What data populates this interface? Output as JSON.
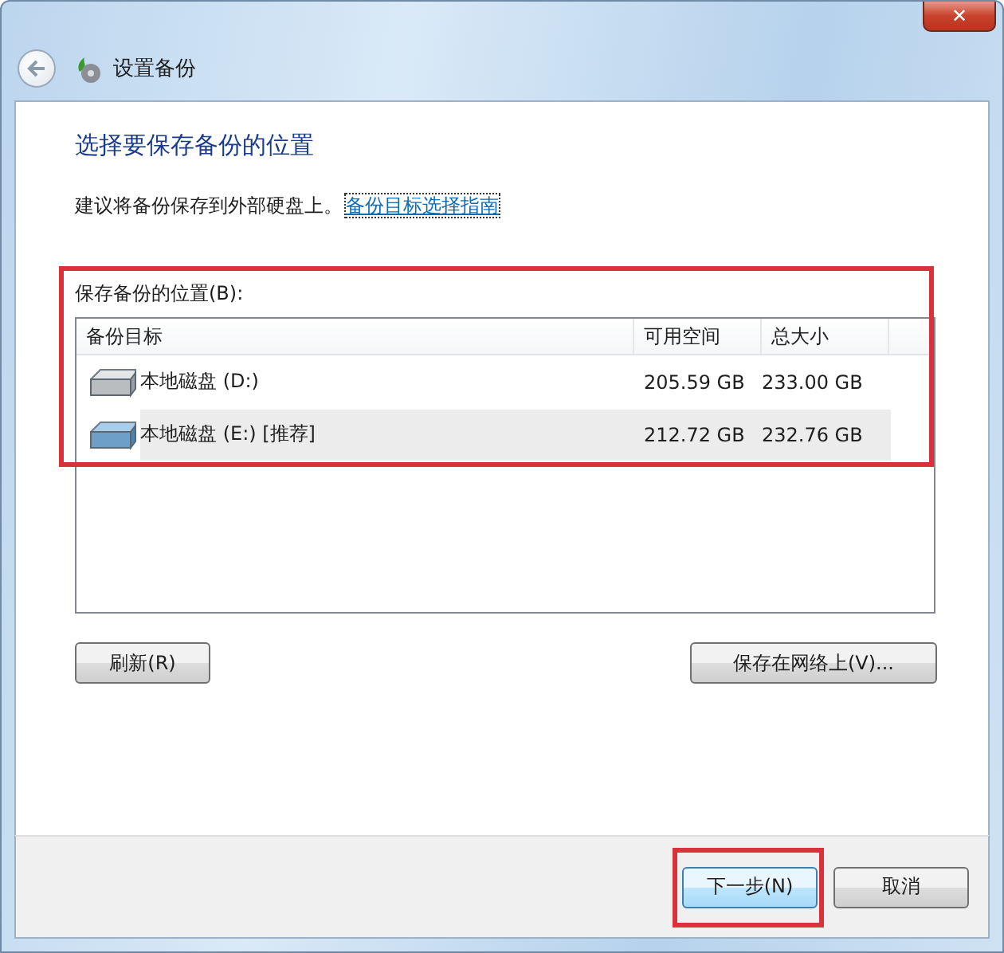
{
  "window": {
    "title": "设置备份",
    "close_label": "✕"
  },
  "heading": "选择要保存备份的位置",
  "intro": {
    "text": "建议将备份保存到外部硬盘上。",
    "link": "备份目标选择指南"
  },
  "list_label": "保存备份的位置(B):",
  "table": {
    "columns": [
      "备份目标",
      "可用空间",
      "总大小"
    ],
    "rows": [
      {
        "name": "本地磁盘 (D:)",
        "free": "205.59 GB",
        "total": "233.00 GB",
        "selected": false,
        "kind": "grey"
      },
      {
        "name": "本地磁盘 (E:) [推荐]",
        "free": "212.72 GB",
        "total": "232.76 GB",
        "selected": true,
        "kind": "blue"
      }
    ]
  },
  "buttons": {
    "refresh": "刷新(R)",
    "network": "保存在网络上(V)...",
    "next": "下一步(N)",
    "cancel": "取消"
  }
}
